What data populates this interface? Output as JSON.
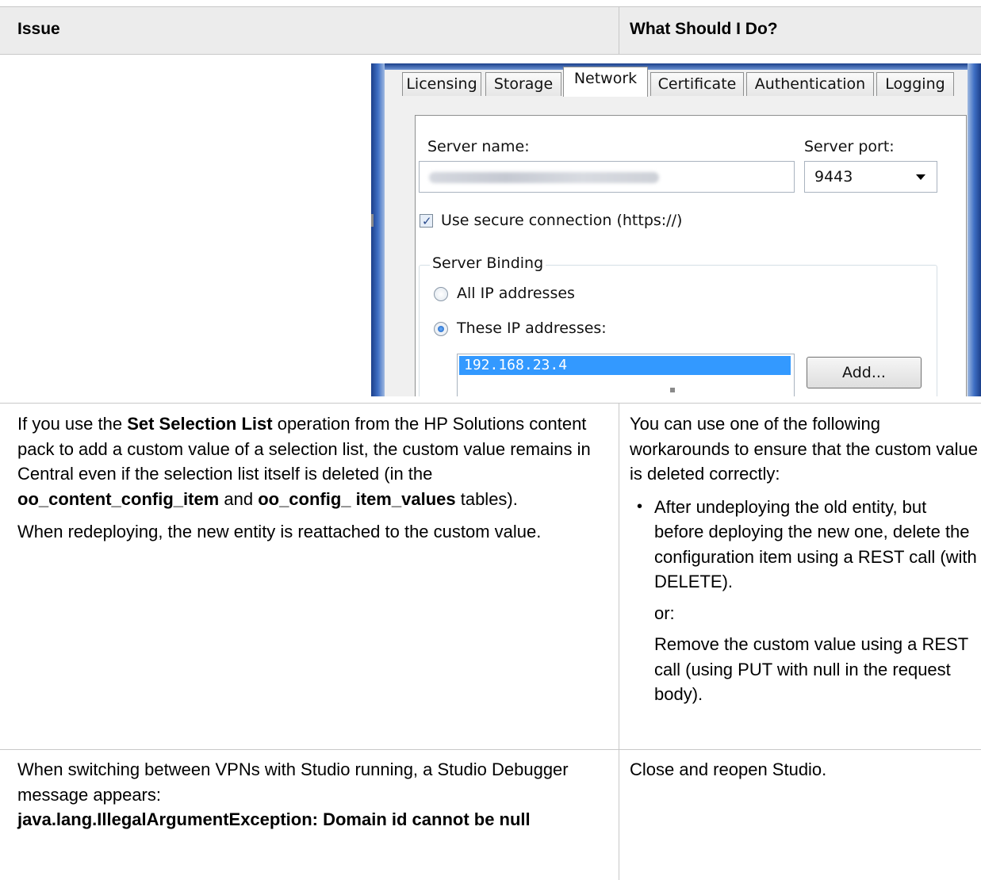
{
  "table": {
    "headers": {
      "issue": "Issue",
      "action": "What Should I Do?"
    }
  },
  "screenshot": {
    "tabs": [
      "Licensing",
      "Storage",
      "Network",
      "Certificate",
      "Authentication",
      "Logging"
    ],
    "active_tab": "Network",
    "server_name_label": "Server name:",
    "server_port_label": "Server port:",
    "server_port_value": "9443",
    "secure_connection_label": "Use secure connection (https://)",
    "secure_connection_checked": true,
    "binding_group_label": "Server Binding",
    "radio_all": "All IP addresses",
    "radio_these": "These IP addresses:",
    "ip_list": [
      "192.168.23.4"
    ],
    "add_button": "Add..."
  },
  "row2": {
    "issue_p1": [
      "If you use the ",
      "Set Selection List",
      " operation from the HP Solutions content pack to add a custom value of a selection list, the custom value remains in Central even if the selection list itself is deleted (in the ",
      "oo_content_config_item",
      " and ",
      "oo_config_ item_values",
      " tables)."
    ],
    "issue_p2": "When redeploying, the new entity is reattached to the custom value.",
    "action_intro": "You can use one of the following workarounds to ensure that the custom value is deleted correctly:",
    "action_bullet": "After undeploying the old entity, but before deploying the new one, delete the configuration item using a REST call (with DELETE).",
    "action_or": "or:",
    "action_alt": "Remove the custom value using a REST call (using PUT with null in the request body)."
  },
  "row3": {
    "issue_text": "When switching between VPNs with Studio running, a Studio Debugger message appears:",
    "issue_error": "java.lang.IllegalArgumentException: Domain id cannot be null",
    "action": "Close and reopen Studio."
  },
  "colors": {
    "header_bg": "#ececec",
    "grid": "#c8c8c8",
    "selection": "#3399ff"
  }
}
